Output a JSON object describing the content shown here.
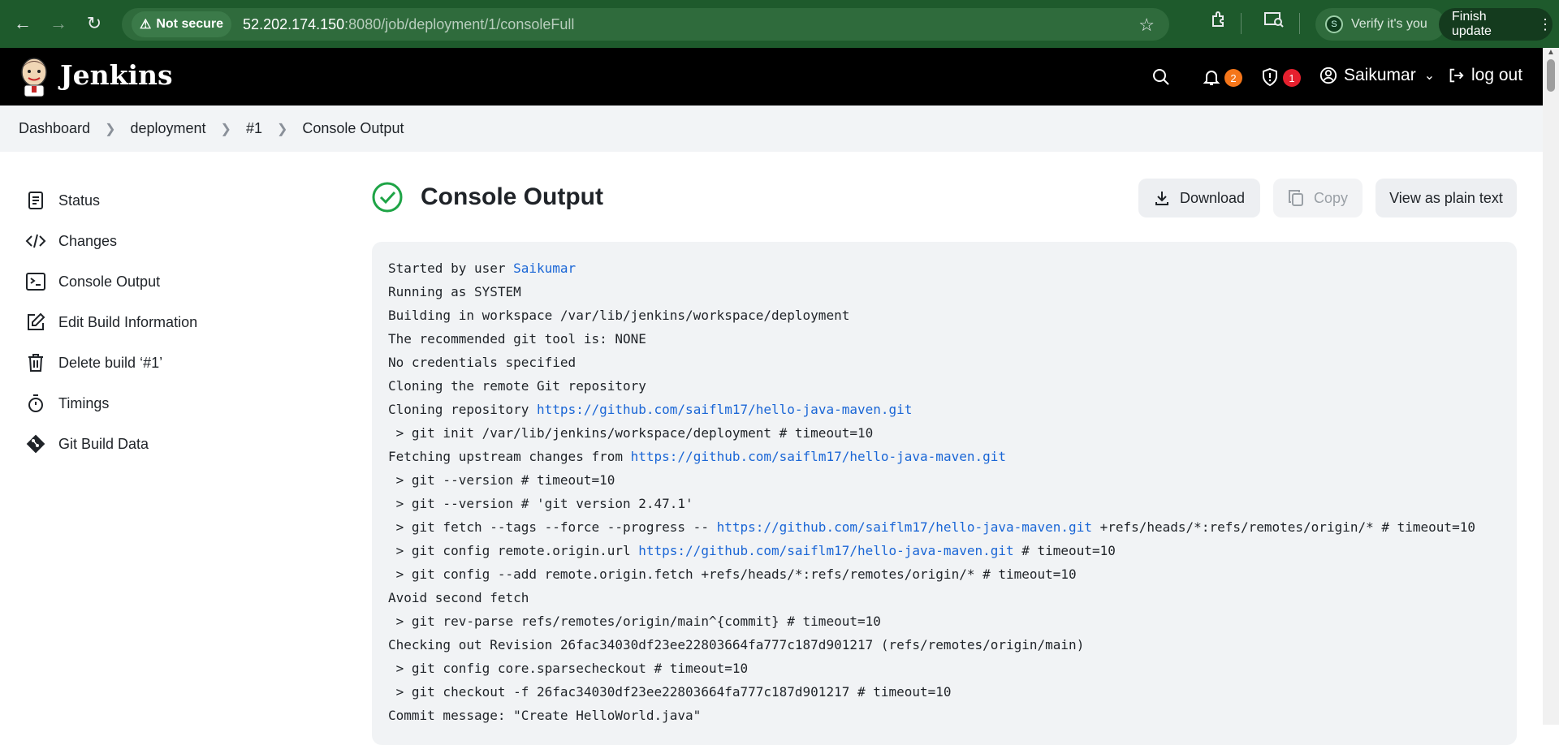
{
  "browser": {
    "not_secure": "Not secure",
    "url_host": "52.202.174.150",
    "url_rest": ":8080/job/deployment/1/consoleFull",
    "verify": "Verify it's you",
    "verify_avatar": "S",
    "finish_update": "Finish update"
  },
  "header": {
    "brand": "Jenkins",
    "notifications_count": "2",
    "security_count": "1",
    "user": "Saikumar",
    "logout": "log out",
    "notif_color": "#f5761a",
    "security_color": "#e5202e"
  },
  "breadcrumb": [
    "Dashboard",
    "deployment",
    "#1",
    "Console Output"
  ],
  "sidebar": {
    "items": [
      {
        "label": "Status",
        "icon": "document-icon"
      },
      {
        "label": "Changes",
        "icon": "code-icon"
      },
      {
        "label": "Console Output",
        "icon": "terminal-icon"
      },
      {
        "label": "Edit Build Information",
        "icon": "edit-icon"
      },
      {
        "label": "Delete build ‘#1’",
        "icon": "trash-icon"
      },
      {
        "label": "Timings",
        "icon": "stopwatch-icon"
      },
      {
        "label": "Git Build Data",
        "icon": "git-icon"
      }
    ]
  },
  "main": {
    "title": "Console Output",
    "download": "Download",
    "copy": "Copy",
    "plain_text": "View as plain text",
    "status_color": "#1ea446"
  },
  "console": {
    "lines": [
      [
        {
          "t": "Started by user "
        },
        {
          "t": "Saikumar",
          "link": true
        }
      ],
      [
        {
          "t": "Running as SYSTEM"
        }
      ],
      [
        {
          "t": "Building in workspace /var/lib/jenkins/workspace/deployment"
        }
      ],
      [
        {
          "t": "The recommended git tool is: NONE"
        }
      ],
      [
        {
          "t": "No credentials specified"
        }
      ],
      [
        {
          "t": "Cloning the remote Git repository"
        }
      ],
      [
        {
          "t": "Cloning repository "
        },
        {
          "t": "https://github.com/saiflm17/hello-java-maven.git",
          "link": true
        }
      ],
      [
        {
          "t": " > git init /var/lib/jenkins/workspace/deployment # timeout=10"
        }
      ],
      [
        {
          "t": "Fetching upstream changes from "
        },
        {
          "t": "https://github.com/saiflm17/hello-java-maven.git",
          "link": true
        }
      ],
      [
        {
          "t": " > git --version # timeout=10"
        }
      ],
      [
        {
          "t": " > git --version # 'git version 2.47.1'"
        }
      ],
      [
        {
          "t": " > git fetch --tags --force --progress -- "
        },
        {
          "t": "https://github.com/saiflm17/hello-java-maven.git",
          "link": true
        },
        {
          "t": " +refs/heads/*:refs/remotes/origin/* # timeout=10"
        }
      ],
      [
        {
          "t": " > git config remote.origin.url "
        },
        {
          "t": "https://github.com/saiflm17/hello-java-maven.git",
          "link": true
        },
        {
          "t": " # timeout=10"
        }
      ],
      [
        {
          "t": " > git config --add remote.origin.fetch +refs/heads/*:refs/remotes/origin/* # timeout=10"
        }
      ],
      [
        {
          "t": "Avoid second fetch"
        }
      ],
      [
        {
          "t": " > git rev-parse refs/remotes/origin/main^{commit} # timeout=10"
        }
      ],
      [
        {
          "t": "Checking out Revision 26fac34030df23ee22803664fa777c187d901217 (refs/remotes/origin/main)"
        }
      ],
      [
        {
          "t": " > git config core.sparsecheckout # timeout=10"
        }
      ],
      [
        {
          "t": " > git checkout -f 26fac34030df23ee22803664fa777c187d901217 # timeout=10"
        }
      ],
      [
        {
          "t": "Commit message: \"Create HelloWorld.java\""
        }
      ]
    ]
  }
}
